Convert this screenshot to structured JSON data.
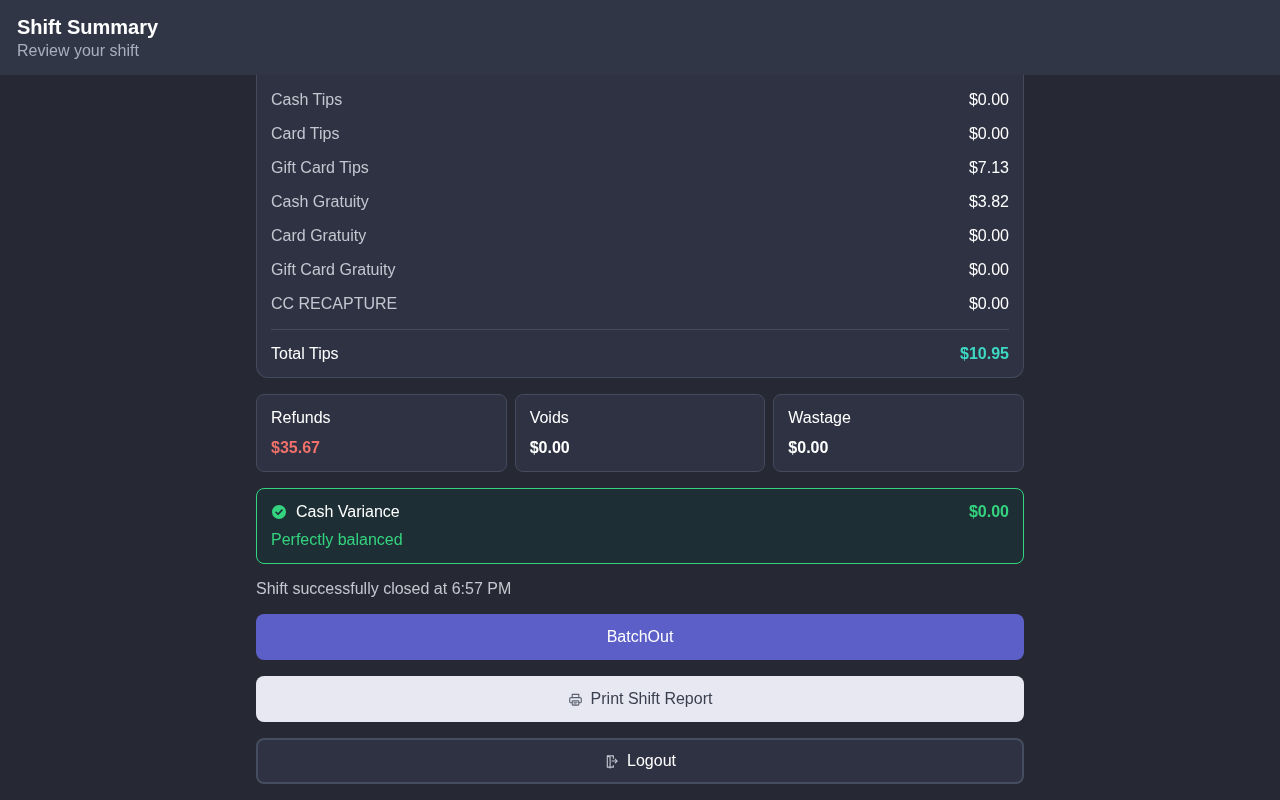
{
  "header": {
    "title": "Shift Summary",
    "subtitle": "Review your shift"
  },
  "tips": {
    "rows": [
      {
        "label": "Cash Tips",
        "value": "$0.00"
      },
      {
        "label": "Card Tips",
        "value": "$0.00"
      },
      {
        "label": "Gift Card Tips",
        "value": "$7.13"
      },
      {
        "label": "Cash Gratuity",
        "value": "$3.82"
      },
      {
        "label": "Card Gratuity",
        "value": "$0.00"
      },
      {
        "label": "Gift Card Gratuity",
        "value": "$0.00"
      },
      {
        "label": "CC RECAPTURE",
        "value": "$0.00"
      }
    ],
    "total": {
      "label": "Total Tips",
      "value": "$10.95"
    }
  },
  "stats": [
    {
      "label": "Refunds",
      "value": "$35.67",
      "color": "#f0706a"
    },
    {
      "label": "Voids",
      "value": "$0.00",
      "color": "#ffffff"
    },
    {
      "label": "Wastage",
      "value": "$0.00",
      "color": "#ffffff"
    }
  ],
  "cash_variance": {
    "label": "Cash Variance",
    "amount": "$0.00",
    "status": "Perfectly balanced",
    "balanced": true
  },
  "closed_message": "Shift successfully closed at 6:57 PM",
  "buttons": [
    {
      "kind": "primary",
      "label": "BatchOut"
    },
    {
      "kind": "print",
      "label": "Print Shift Report"
    },
    {
      "kind": "logout",
      "label": "Logout"
    }
  ]
}
